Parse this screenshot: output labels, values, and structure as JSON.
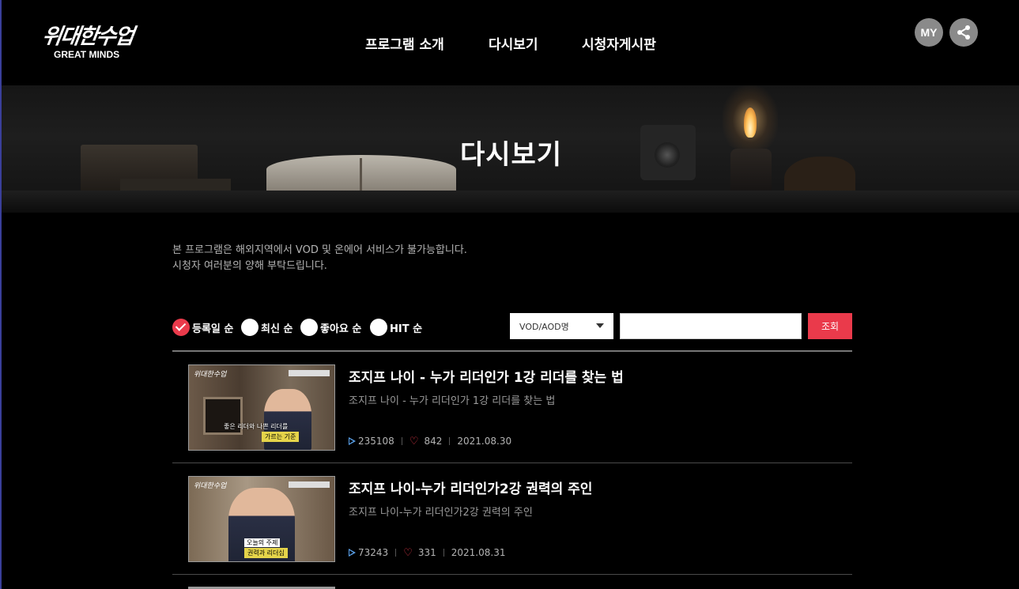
{
  "header": {
    "logo_kr": "위대한수업",
    "logo_en": "GREAT MINDS",
    "nav": [
      "프로그램 소개",
      "다시보기",
      "시청자게시판"
    ],
    "my_label": "MY"
  },
  "banner": {
    "title": "다시보기"
  },
  "notice": {
    "line1": "본 프로그램은 해외지역에서 VOD 및 온에어 서비스가 불가능합니다.",
    "line2": "시청자 여러분의 양해 부탁드립니다."
  },
  "sort": {
    "options": [
      "등록일 순",
      "최신 순",
      "좋아요 순",
      "HIT 순"
    ],
    "selected": "등록일 순"
  },
  "search": {
    "select_value": "VOD/AOD명",
    "input_value": "",
    "button": "조회"
  },
  "items": [
    {
      "title": "조지프 나이 - 누가 리더인가 1강 리더를 찾는 법",
      "subtitle": "조지프 나이 - 누가 리더인가 1강 리더를 찾는 법",
      "views": "235108",
      "likes": "842",
      "date": "2021.08.30",
      "thumb_logo": "위대한수업",
      "thumb_caption1": "좋은 리더와 나쁜 리더를",
      "thumb_caption2": "가르는 기준"
    },
    {
      "title": "조지프 나이-누가 리더인가2강 권력의 주인",
      "subtitle": "조지프 나이-누가 리더인가2강 권력의 주인",
      "views": "73243",
      "likes": "331",
      "date": "2021.08.31",
      "thumb_logo": "위대한수업",
      "thumb_caption1": "오늘의 주제",
      "thumb_caption2": "권력과 리더십"
    }
  ],
  "colors": {
    "accent": "#ea3a4b",
    "background": "#000000",
    "play_icon": "#5aa0e8"
  },
  "icons": [
    "check-icon",
    "share-icon",
    "play-icon",
    "heart-icon",
    "chevron-down-icon"
  ]
}
